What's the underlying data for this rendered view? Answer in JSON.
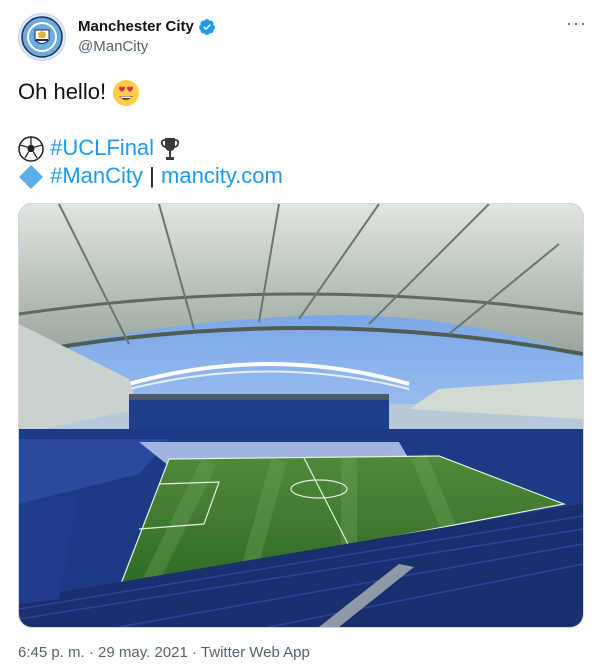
{
  "author": {
    "display_name": "Manchester City",
    "handle": "@ManCity",
    "avatar": "manchester-city-crest",
    "verified": true
  },
  "more_icon": "more-options-icon",
  "tweet": {
    "greeting": "Oh hello!",
    "hashtag_ucl": "#UCLFinal",
    "hashtag_mancity": "#ManCity",
    "separator": "|",
    "link": "mancity.com"
  },
  "media": {
    "description_icon": "stadium-photo"
  },
  "meta": {
    "time": "6:45 p. m.",
    "dot": "·",
    "date": "29 may. 2021",
    "source": "Twitter Web App"
  },
  "colors": {
    "link": "#1d9bf0",
    "secondary_text": "#536471",
    "primary_text": "#0f1419",
    "verified": "#1d9bf0"
  }
}
